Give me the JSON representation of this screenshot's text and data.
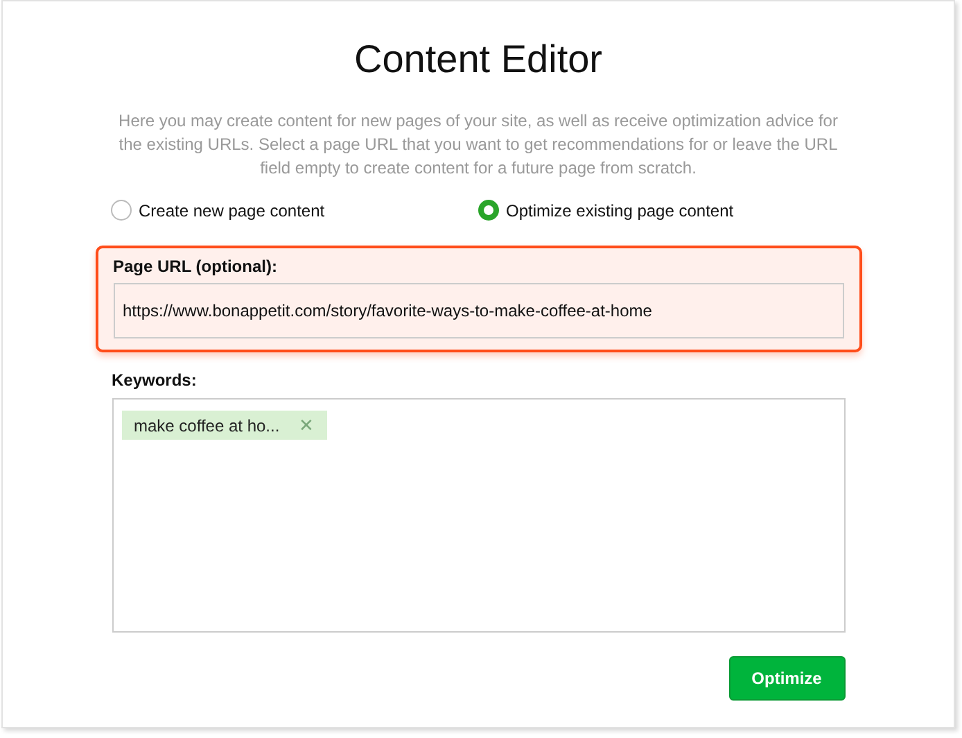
{
  "title": "Content Editor",
  "description": "Here you may create content for new pages of your site, as well as receive optimization advice for the existing URLs. Select a page URL that you want to get recommendations for or leave the URL field empty to create content for a future page from scratch.",
  "modes": [
    {
      "label": "Create new page content",
      "selected": false
    },
    {
      "label": "Optimize existing page content",
      "selected": true
    }
  ],
  "url_field": {
    "label": "Page URL (optional):",
    "value": "https://www.bonappetit.com/story/favorite-ways-to-make-coffee-at-home",
    "highlighted": true
  },
  "keywords": {
    "label": "Keywords:",
    "tags": [
      {
        "text": "make coffee at ho...",
        "remove": "✕"
      }
    ]
  },
  "button": "Optimize"
}
